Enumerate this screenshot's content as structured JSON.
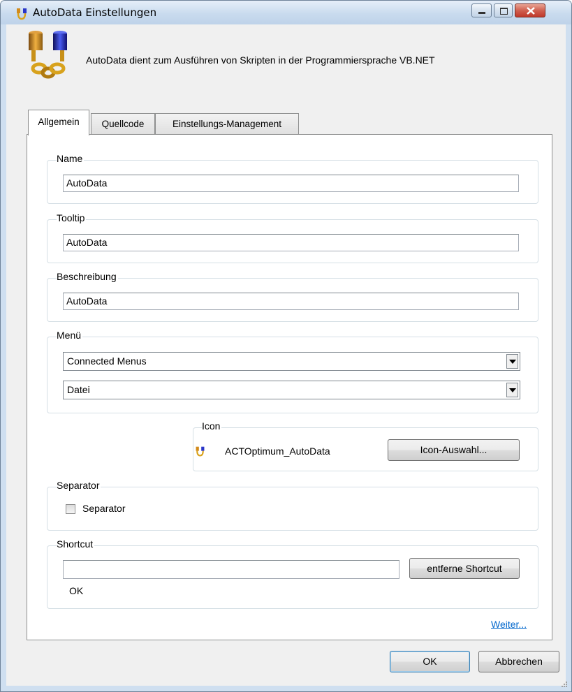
{
  "window": {
    "title": "AutoData Einstellungen"
  },
  "intro": {
    "text": "AutoData dient zum Ausführen von Skripten in der Programmiersprache VB.NET"
  },
  "tabs": [
    {
      "label": "Allgemein",
      "active": true
    },
    {
      "label": "Quellcode",
      "active": false
    },
    {
      "label": "Einstellungs-Management",
      "active": false
    }
  ],
  "name_group": {
    "label": "Name",
    "value": "AutoData"
  },
  "tooltip_group": {
    "label": "Tooltip",
    "value": "AutoData"
  },
  "description_group": {
    "label": "Beschreibung",
    "value": "AutoData"
  },
  "menu_group": {
    "label": "Menü",
    "select1": "Connected Menus",
    "select2": "Datei"
  },
  "icon_group": {
    "label": "Icon",
    "icon_name": "ACTOptimum_AutoData",
    "button": "Icon-Auswahl..."
  },
  "separator_group": {
    "label": "Separator",
    "checkbox_label": "Separator",
    "checked": false
  },
  "shortcut_group": {
    "label": "Shortcut",
    "value": "",
    "remove_button": "entferne Shortcut",
    "status": "OK"
  },
  "more_link": "Weiter...",
  "footer": {
    "ok": "OK",
    "cancel": "Abbrechen"
  },
  "colors": {
    "link": "#0066cc",
    "close_button": "#c0392b",
    "title_bar": "#c9dbee"
  }
}
